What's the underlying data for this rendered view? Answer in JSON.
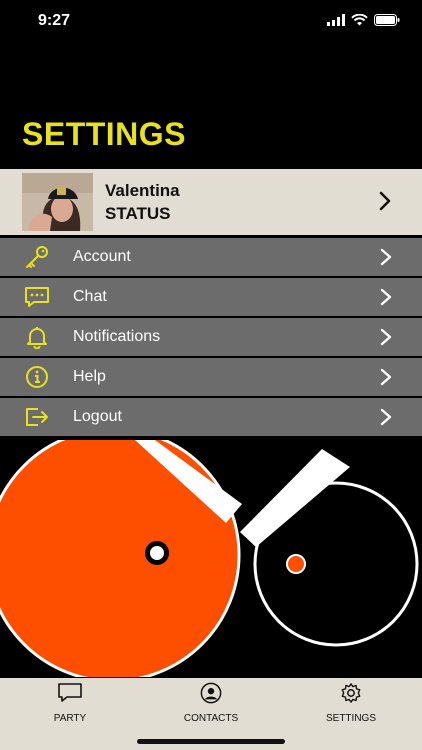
{
  "status_bar": {
    "time": "9:27"
  },
  "header": {
    "title": "SETTINGS"
  },
  "profile": {
    "name": "Valentina",
    "status": "STATUS"
  },
  "menu": {
    "items": [
      {
        "label": "Account",
        "icon": "key-icon"
      },
      {
        "label": "Chat",
        "icon": "chat-bubble-icon"
      },
      {
        "label": "Notifications",
        "icon": "bell-icon"
      },
      {
        "label": "Help",
        "icon": "info-icon"
      },
      {
        "label": "Logout",
        "icon": "logout-icon"
      }
    ]
  },
  "tabbar": {
    "tabs": [
      {
        "label": "PARTY",
        "icon": "chat-bubble-icon"
      },
      {
        "label": "CONTACTS",
        "icon": "user-circle-icon"
      },
      {
        "label": "SETTINGS",
        "icon": "gear-icon"
      }
    ]
  },
  "colors": {
    "accent": "#e7e21c",
    "orange": "#fe4e00",
    "menu_bg": "#6c6c6c",
    "panel_bg": "#e2ddd2"
  }
}
